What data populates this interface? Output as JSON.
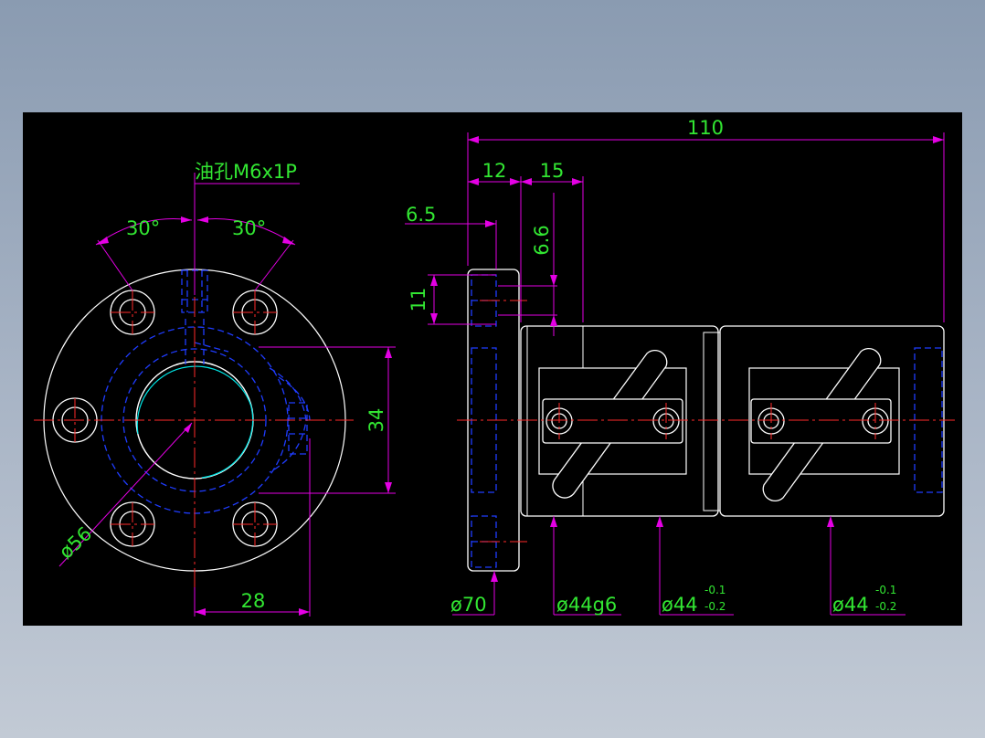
{
  "colors": {
    "background": "#000000",
    "outline": "#ffffff",
    "hidden": "#1f3cff",
    "center": "#ff2a2a",
    "dimension": "#e400e4",
    "dim_text": "#32e632",
    "cyan": "#00e5e5"
  },
  "front_view": {
    "oil_hole_label": "油孔M6x1P",
    "angle_left": "30°",
    "angle_right": "30°",
    "dim_height": "34",
    "dim_width": "28",
    "dim_pcd": "ø56"
  },
  "side_view": {
    "dim_total": "110",
    "dim_12": "12",
    "dim_15": "15",
    "dim_6_5": "6.5",
    "dim_6_6": "6.6",
    "dim_11": "11",
    "dim_flange_dia": "ø70",
    "dim_g6": "ø44g6",
    "dim_body1": "ø44",
    "dim_body1_upper": "-0.1",
    "dim_body1_lower": "-0.2",
    "dim_body2": "ø44",
    "dim_body2_upper": "-0.1",
    "dim_body2_lower": "-0.2"
  }
}
